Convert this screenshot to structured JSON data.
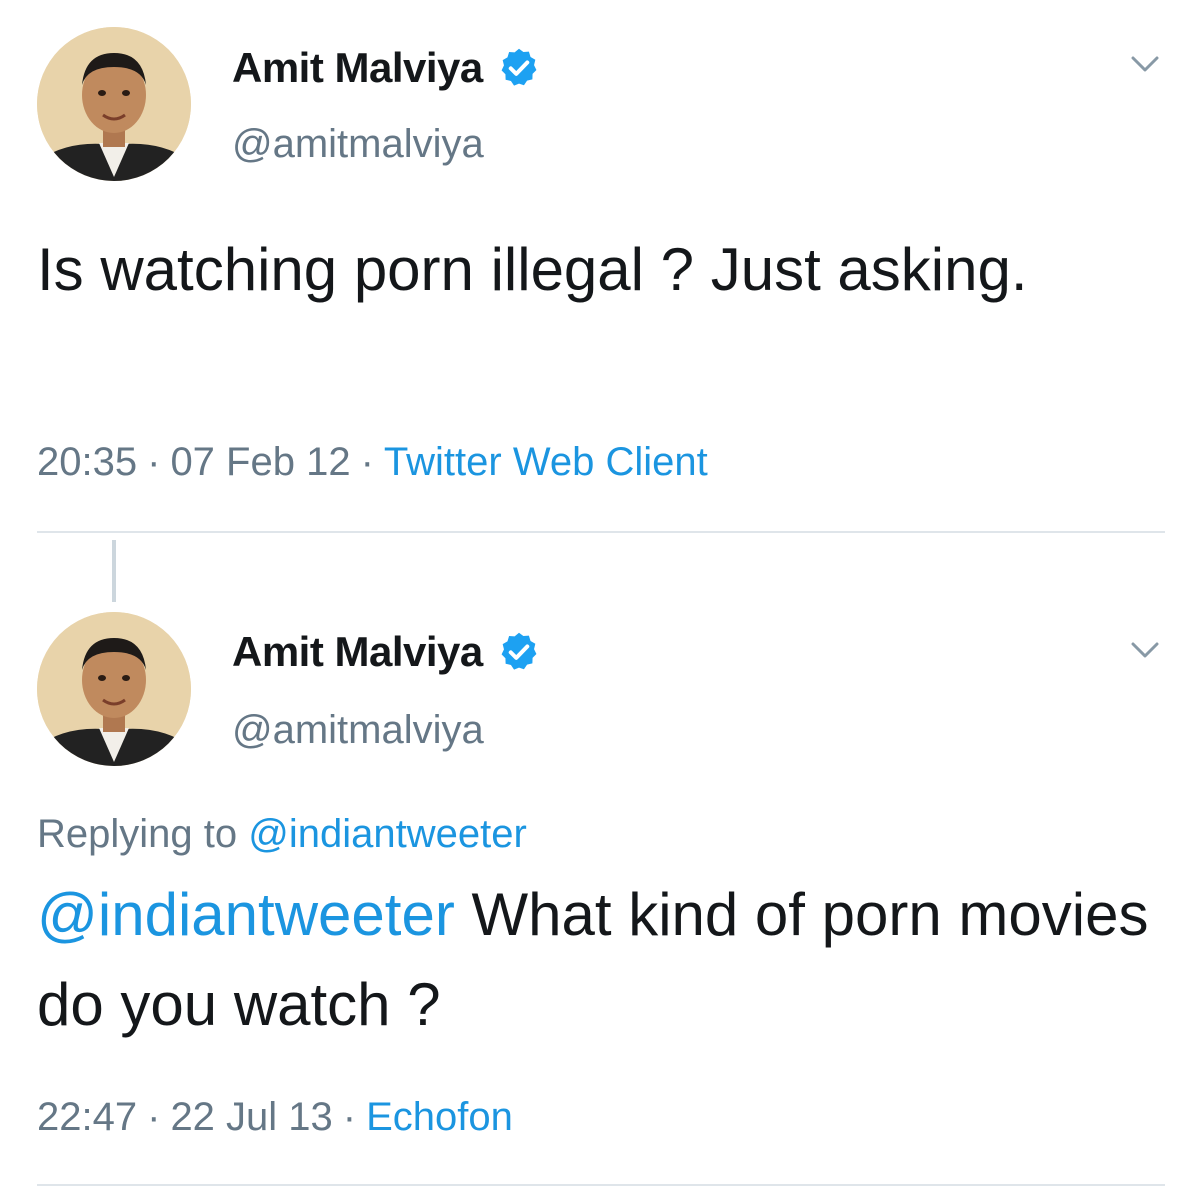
{
  "tweets": [
    {
      "display_name": "Amit Malviya",
      "handle": "@amitmalviya",
      "text": "Is watching porn illegal ? Just asking.",
      "time": "20:35",
      "date": "07 Feb 12",
      "source": "Twitter Web Client",
      "separator": "·"
    },
    {
      "display_name": "Amit Malviya",
      "handle": "@amitmalviya",
      "replying_prefix": "Replying to",
      "replying_to": "@indiantweeter",
      "mention": "@indiantweeter",
      "text": "What kind of porn movies do you watch ?",
      "time": "22:47",
      "date": "22 Jul 13",
      "source": "Echofon",
      "separator": "·"
    }
  ],
  "icons": {
    "verified": "verified-badge-icon",
    "caret": "chevron-down-icon"
  },
  "colors": {
    "link": "#1b95e0",
    "secondary_text": "#657786",
    "primary_text": "#14171a",
    "verified": "#1da1f2"
  }
}
